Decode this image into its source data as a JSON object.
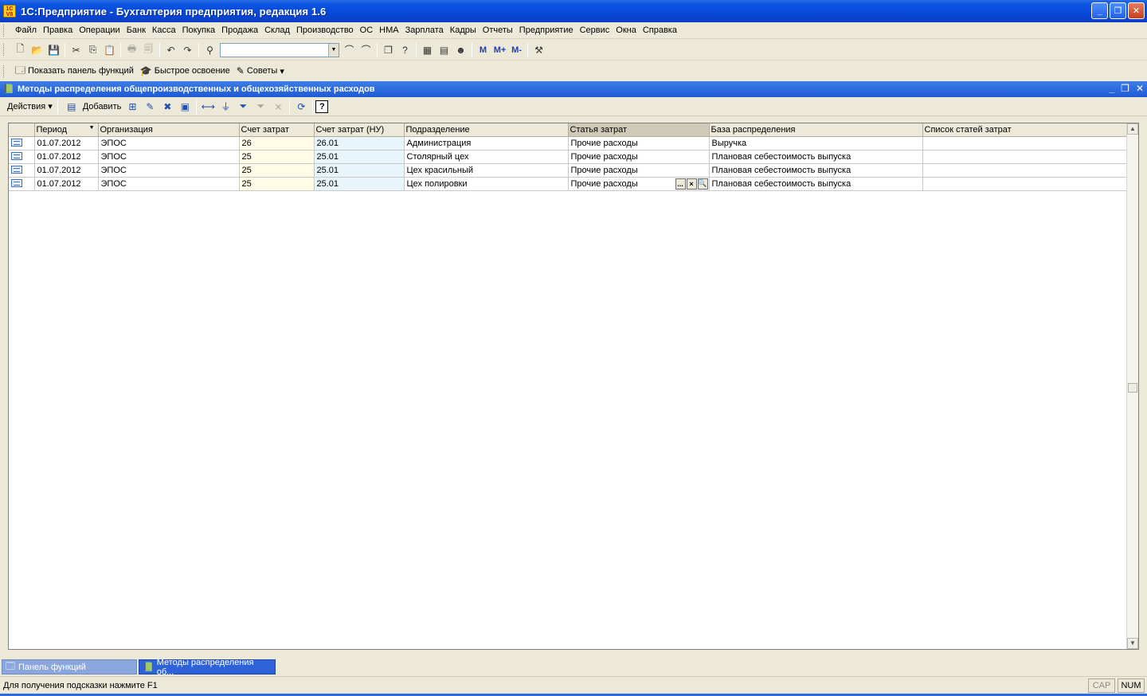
{
  "window": {
    "title": "1С:Предприятие - Бухгалтерия предприятия, редакция 1.6",
    "app_icon_text": "1C V8"
  },
  "menu": [
    "Файл",
    "Правка",
    "Операции",
    "Банк",
    "Касса",
    "Покупка",
    "Продажа",
    "Склад",
    "Производство",
    "ОС",
    "НМА",
    "Зарплата",
    "Кадры",
    "Отчеты",
    "Предприятие",
    "Сервис",
    "Окна",
    "Справка"
  ],
  "toolbar": {
    "m_label": "M",
    "mplus_label": "M+",
    "mminus_label": "M-"
  },
  "panel": {
    "show_functions": "Показать панель функций",
    "quick_learning": "Быстрое освоение",
    "tips": "Советы"
  },
  "child_window": {
    "title": "Методы распределения общепроизводственных и общехозяйственных расходов",
    "actions_label": "Действия",
    "add_label": "Добавить",
    "help_label": "?"
  },
  "grid": {
    "columns": [
      "",
      "Период",
      "Организация",
      "Счет затрат",
      "Счет затрат (НУ)",
      "Подразделение",
      "Статья затрат",
      "База распределения",
      "Список статей затрат"
    ],
    "rows": [
      {
        "period": "01.07.2012",
        "org": "ЭПОС",
        "account": "26",
        "account_nu": "26.01",
        "division": "Администрация",
        "cost_item": "Прочие расходы",
        "base": "Выручка",
        "list": ""
      },
      {
        "period": "01.07.2012",
        "org": "ЭПОС",
        "account": "25",
        "account_nu": "25.01",
        "division": "Столярный цех",
        "cost_item": "Прочие расходы",
        "base": "Плановая себестоимость выпуска",
        "list": ""
      },
      {
        "period": "01.07.2012",
        "org": "ЭПОС",
        "account": "25",
        "account_nu": "25.01",
        "division": "Цех красильный",
        "cost_item": "Прочие расходы",
        "base": "Плановая себестоимость выпуска",
        "list": ""
      },
      {
        "period": "01.07.2012",
        "org": "ЭПОС",
        "account": "25",
        "account_nu": "25.01",
        "division": "Цех полировки",
        "cost_item": "Прочие расходы",
        "base": "Плановая себестоимость выпуска",
        "list": ""
      }
    ],
    "cell_buttons": [
      "...",
      "×",
      "🔍"
    ]
  },
  "tabs": [
    "Панель функций",
    "Методы распределения об..."
  ],
  "status": {
    "hint": "Для получения подсказки нажмите F1",
    "cap": "CAP",
    "num": "NUM"
  }
}
